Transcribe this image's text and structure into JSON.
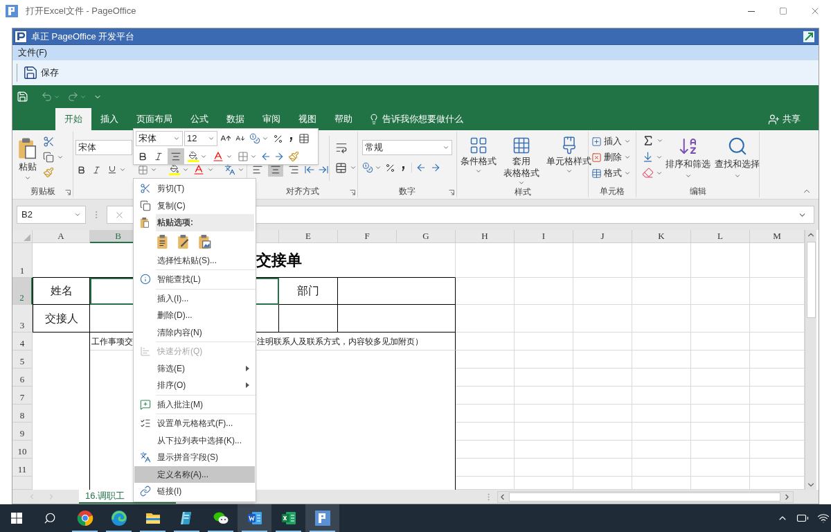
{
  "window": {
    "title": "打开Excel文件 - PageOffice"
  },
  "app_bar": {
    "title": "卓正 PageOffice 开发平台"
  },
  "menu_bar": [
    {
      "label": "文件(F)"
    }
  ],
  "toolbar": [
    {
      "label": "保存"
    }
  ],
  "ribbon_tabs": [
    {
      "label": "开始",
      "selected": true
    },
    {
      "label": "插入",
      "selected": false
    },
    {
      "label": "页面布局",
      "selected": false
    },
    {
      "label": "公式",
      "selected": false
    },
    {
      "label": "数据",
      "selected": false
    },
    {
      "label": "审阅",
      "selected": false
    },
    {
      "label": "视图",
      "selected": false
    },
    {
      "label": "帮助",
      "selected": false
    }
  ],
  "tell_me": {
    "placeholder": "告诉我你想要做什么"
  },
  "share": {
    "label": "共享"
  },
  "ribbon": {
    "paste": "粘贴",
    "clipboard_label": "剪贴板",
    "font_name": "宋体",
    "align_buttons": [
      {
        "selected": false
      },
      {
        "selected": true
      },
      {
        "selected": false
      }
    ],
    "alignment_label": "对齐方式",
    "number_format": "常规",
    "number_label": "数字",
    "styles": [
      {
        "lines": [
          "条件格式"
        ]
      },
      {
        "lines": [
          "套用",
          "表格格式"
        ]
      },
      {
        "lines": [
          "单元格样式"
        ]
      }
    ],
    "styles_label": "样式",
    "cells": [
      "插入",
      "删除",
      "格式"
    ],
    "cells_label": "单元格",
    "editing": [
      "排序和筛选",
      "查找和选择"
    ],
    "editing_label": "编辑"
  },
  "mini_toolbar": {
    "font_name": "宋体",
    "font_size": "12",
    "align_center": {
      "selected": true
    }
  },
  "formula_bar": {
    "name_box": "B2"
  },
  "sheet": {
    "columns": [
      {
        "label": "A",
        "selected": false
      },
      {
        "label": "B",
        "selected": true
      },
      {
        "label": "E",
        "selected": false
      },
      {
        "label": "F",
        "selected": false
      },
      {
        "label": "G",
        "selected": false
      },
      {
        "label": "H",
        "selected": false
      },
      {
        "label": "I",
        "selected": false
      },
      {
        "label": "J",
        "selected": false
      },
      {
        "label": "K",
        "selected": false
      },
      {
        "label": "L",
        "selected": false
      },
      {
        "label": "M",
        "selected": false
      }
    ],
    "rows": [
      {
        "label": "1",
        "selected": false,
        "kind": "title",
        "title": "交接单"
      },
      {
        "label": "2",
        "selected": true,
        "kind": "form",
        "field": "姓名",
        "field2": "部门"
      },
      {
        "label": "3",
        "selected": false,
        "kind": "form",
        "field": "交接人"
      },
      {
        "label": "4",
        "selected": false,
        "kind": "note",
        "text": "工作事项交",
        "text2": "注明联系人及联系方式，内容较多见加附页）"
      },
      {
        "label": "5",
        "selected": false,
        "kind": "blank"
      },
      {
        "label": "6",
        "selected": false,
        "kind": "blank"
      },
      {
        "label": "7",
        "selected": false,
        "kind": "blank"
      },
      {
        "label": "8",
        "selected": false,
        "kind": "blank"
      },
      {
        "label": "9",
        "selected": false,
        "kind": "blank"
      },
      {
        "label": "10",
        "selected": false,
        "kind": "blank"
      },
      {
        "label": "11",
        "selected": false,
        "kind": "blank"
      }
    ]
  },
  "sheet_tabs": [
    {
      "label": "16.调职工",
      "selected": true
    }
  ],
  "context_menu": [
    {
      "kind": "item",
      "label": "剪切(T)",
      "selected": false,
      "disabled": false,
      "submenu": false
    },
    {
      "kind": "item",
      "label": "复制(C)",
      "selected": false,
      "disabled": false,
      "submenu": false
    },
    {
      "kind": "header",
      "label": "粘贴选项:"
    },
    {
      "kind": "paste-options"
    },
    {
      "kind": "item",
      "label": "选择性粘贴(S)...",
      "selected": false,
      "disabled": false,
      "submenu": false
    },
    {
      "kind": "separator"
    },
    {
      "kind": "item",
      "label": "智能查找(L)",
      "selected": false,
      "disabled": false,
      "submenu": false
    },
    {
      "kind": "separator"
    },
    {
      "kind": "item",
      "label": "插入(I)...",
      "selected": false,
      "disabled": false,
      "submenu": false
    },
    {
      "kind": "item",
      "label": "删除(D)...",
      "selected": false,
      "disabled": false,
      "submenu": false
    },
    {
      "kind": "item",
      "label": "清除内容(N)",
      "selected": false,
      "disabled": false,
      "submenu": false
    },
    {
      "kind": "separator"
    },
    {
      "kind": "item",
      "label": "快速分析(Q)",
      "selected": false,
      "disabled": true,
      "submenu": false
    },
    {
      "kind": "item",
      "label": "筛选(E)",
      "selected": false,
      "disabled": false,
      "submenu": true
    },
    {
      "kind": "item",
      "label": "排序(O)",
      "selected": false,
      "disabled": false,
      "submenu": true
    },
    {
      "kind": "separator"
    },
    {
      "kind": "item",
      "label": "插入批注(M)",
      "selected": false,
      "disabled": false,
      "submenu": false
    },
    {
      "kind": "separator"
    },
    {
      "kind": "item",
      "label": "设置单元格格式(F)...",
      "selected": false,
      "disabled": false,
      "submenu": false
    },
    {
      "kind": "item",
      "label": "从下拉列表中选择(K)...",
      "selected": false,
      "disabled": false,
      "submenu": false
    },
    {
      "kind": "item",
      "label": "显示拼音字段(S)",
      "selected": false,
      "disabled": false,
      "submenu": false
    },
    {
      "kind": "item",
      "label": "定义名称(A)...",
      "selected": true,
      "disabled": false,
      "submenu": false
    },
    {
      "kind": "item",
      "label": "链接(I)",
      "selected": false,
      "disabled": false,
      "submenu": false
    }
  ],
  "taskbar": {
    "apps": [
      {
        "kind": "chrome",
        "selected": false,
        "running": true
      },
      {
        "kind": "edge",
        "selected": false,
        "running": true
      },
      {
        "kind": "explorer",
        "selected": false,
        "running": true
      },
      {
        "kind": "notes",
        "selected": false,
        "running": true
      },
      {
        "kind": "wechat",
        "selected": false,
        "running": true
      },
      {
        "kind": "word",
        "selected": true,
        "running": true
      },
      {
        "kind": "excel",
        "selected": false,
        "running": true
      },
      {
        "kind": "pageoffice",
        "selected": true,
        "running": true
      }
    ]
  }
}
